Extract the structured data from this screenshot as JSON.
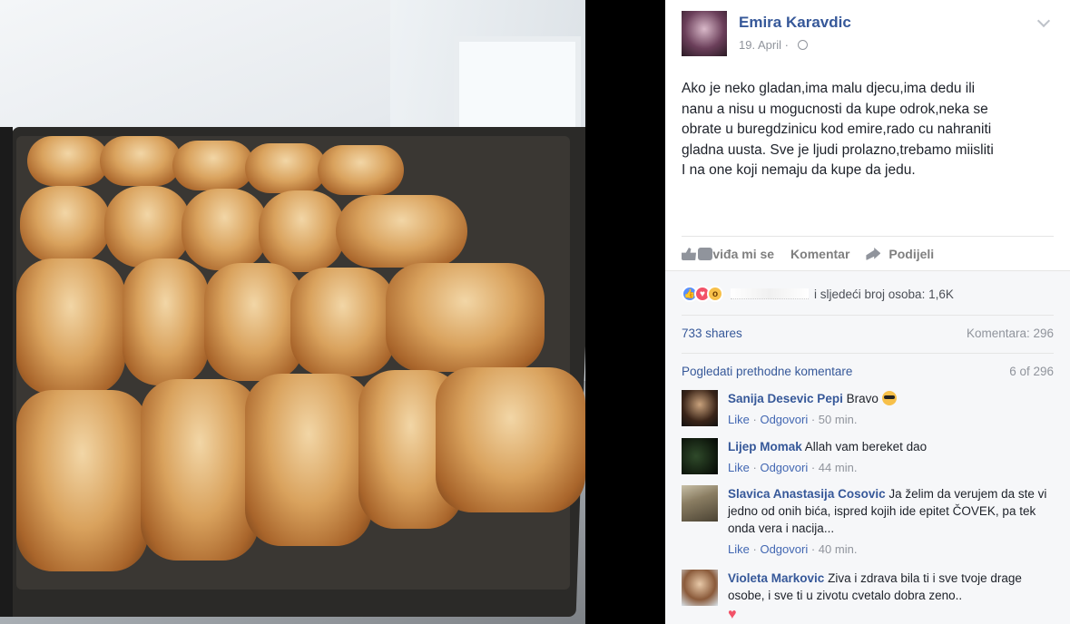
{
  "post": {
    "author": "Emira Karavdic",
    "date": "19. April",
    "date_sep": "·",
    "text": "Ako je neko gladan,ima malu djecu,ima dedu ili\nnanu a nisu u mogucnosti da kupe odrok,neka se\nobrate u buregdzinicu kod emire,rado cu nahraniti\ngladna uusta. Sve je ljudi prolazno,trebamo miisliti\nI na one koji nemaju da kupe da jedu."
  },
  "actions": {
    "like": "Sviđa mi se",
    "comment": "Komentar",
    "share": "Podijeli"
  },
  "reactions": {
    "text": "i sljedeći broj osoba: 1,6K",
    "icons": [
      "like-reaction",
      "love-reaction",
      "wow-reaction"
    ]
  },
  "stats": {
    "shares": "733 shares",
    "comments": "Komentara: 296"
  },
  "comments_nav": {
    "previous": "Pogledati prethodne komentare",
    "count": "6 of 296"
  },
  "comments": [
    {
      "name": "Sanija Desevic Pepi",
      "text": "Bravo",
      "like": "Like",
      "reply": "Odgovori",
      "time": "50 min."
    },
    {
      "name": "Lijep Momak",
      "text": "Allah vam bereket dao",
      "like": "Like",
      "reply": "Odgovori",
      "time": "44 min."
    },
    {
      "name": "Slavica Anastasija Cosovic",
      "text": "Ja želim da verujem da ste vi jedno od onih bića, ispred kojih ide epitet ČOVEK, pa tek onda vera i nacija...",
      "like": "Like",
      "reply": "Odgovori",
      "time": "40 min."
    },
    {
      "name": "Violeta Markovic",
      "text": "Ziva i zdrava bila ti i sve tvoje drage osobe, i sve ti u zivotu cvetalo dobra zeno..",
      "heart": "♥"
    }
  ],
  "meta_sep": "·",
  "colors": {
    "link": "#365899",
    "muted": "#90949c",
    "accent_blue": "#4267b2"
  }
}
